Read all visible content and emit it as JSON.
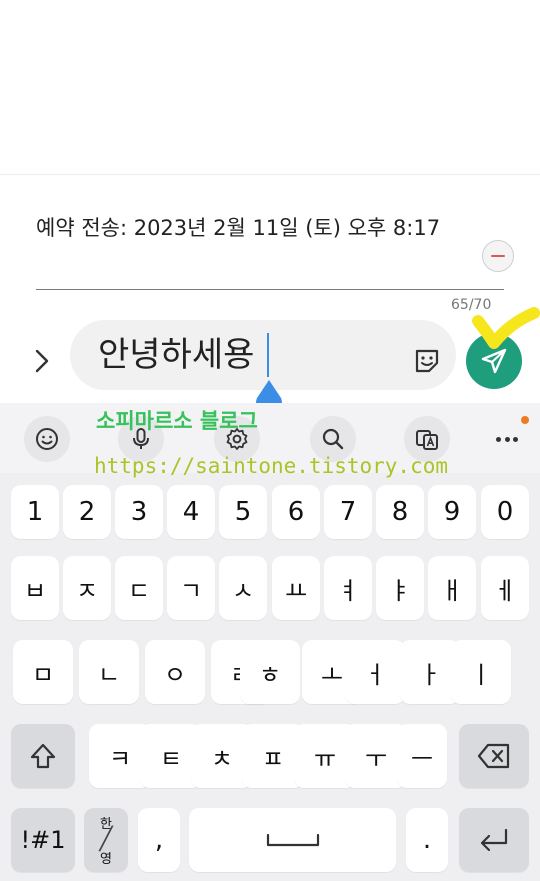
{
  "schedule": {
    "text": "예약 전송: 2023년 2월 11일 (토) 오후 8:17"
  },
  "compose": {
    "char_count": "65/70",
    "message": "안녕하세용"
  },
  "watermark": {
    "title": "소피마르소 블로그",
    "url": "https://saintone.tistory.com"
  },
  "keyboard": {
    "numbers": [
      "1",
      "2",
      "3",
      "4",
      "5",
      "6",
      "7",
      "8",
      "9",
      "0"
    ],
    "row2": [
      "ㅂ",
      "ㅈ",
      "ㄷ",
      "ㄱ",
      "ㅅ",
      "ㅛ",
      "ㅕ",
      "ㅑ",
      "ㅐ",
      "ㅔ"
    ],
    "row3": [
      "ㅁ",
      "ㄴ",
      "ㅇ",
      "ㄹ",
      "ㅎ",
      "ㅗ",
      "ㅓ",
      "ㅏ",
      "ㅣ"
    ],
    "row4": [
      "ㅋ",
      "ㅌ",
      "ㅊ",
      "ㅍ",
      "ㅠ",
      "ㅜ",
      "ㅡ"
    ],
    "symbols_label": "!#1",
    "lang_top": "한",
    "lang_bottom": "영",
    "comma": ",",
    "period": "."
  },
  "colors": {
    "send_button": "#1f9e7e",
    "caret": "#3a8ee6",
    "watermark_title": "#36c15b",
    "watermark_url": "#a9c528",
    "notification_dot": "#ee7a24"
  }
}
